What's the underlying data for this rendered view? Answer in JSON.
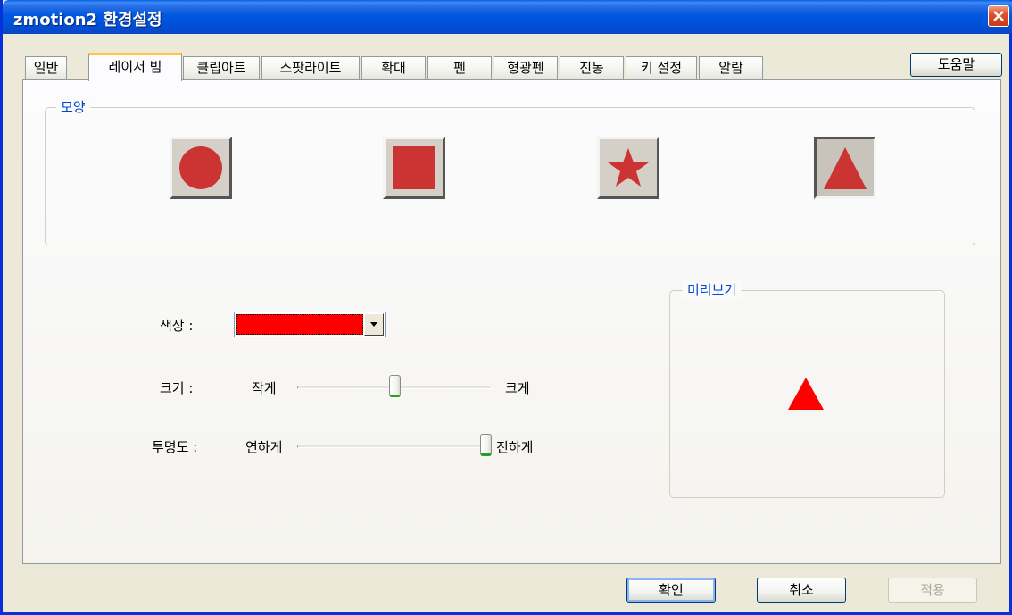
{
  "window": {
    "title": "zmotion2 환경설정"
  },
  "tabs": [
    {
      "label": "일반"
    },
    {
      "label": "레이저 빔"
    },
    {
      "label": "클립아트"
    },
    {
      "label": "스팟라이트"
    },
    {
      "label": "확대"
    },
    {
      "label": "펜"
    },
    {
      "label": "형광펜"
    },
    {
      "label": "진동"
    },
    {
      "label": "키 설정"
    },
    {
      "label": "알람"
    }
  ],
  "active_tab": "레이저 빔",
  "help_label": "도움말",
  "shape_group": {
    "title": "모양",
    "shapes": [
      "circle",
      "square",
      "star",
      "triangle"
    ],
    "selected": "triangle",
    "shape_color": "#cc3333"
  },
  "color": {
    "label": "색상 :",
    "value": "#ff0000"
  },
  "size": {
    "label": "크기 :",
    "min_label": "작게",
    "max_label": "크게",
    "value_fraction": 0.5
  },
  "opacity": {
    "label": "투명도 :",
    "min_label": "연하게",
    "max_label": "진하게",
    "value_fraction": 1.0
  },
  "preview": {
    "title": "미리보기",
    "shape": "triangle",
    "color": "#ff0000"
  },
  "buttons": {
    "ok": "확인",
    "cancel": "취소",
    "apply": "적용"
  }
}
